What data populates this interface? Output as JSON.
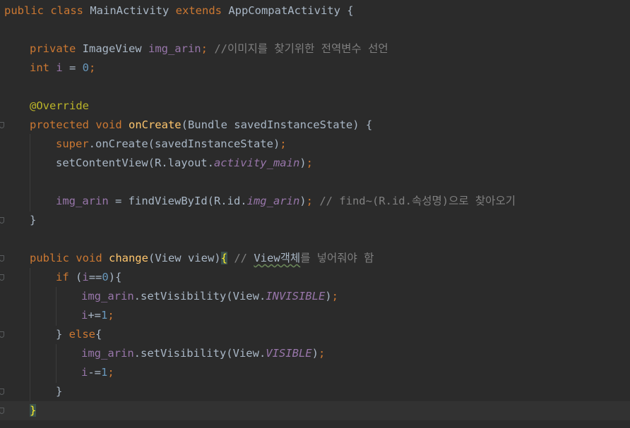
{
  "editor": {
    "lines": [
      {
        "tokens": [
          [
            "kw",
            "public class "
          ],
          [
            "plain",
            "MainActivity "
          ],
          [
            "kw",
            "extends "
          ],
          [
            "plain",
            "AppCompatActivity {"
          ]
        ]
      },
      {
        "tokens": []
      },
      {
        "tokens": [
          [
            "kw",
            "private "
          ],
          [
            "plain",
            "ImageView "
          ],
          [
            "fld",
            "img_arin"
          ],
          [
            "kw",
            "; "
          ],
          [
            "cmt",
            "//이미지를 찾기위한 전역변수 선언"
          ]
        ]
      },
      {
        "tokens": [
          [
            "kw",
            "int "
          ],
          [
            "fld",
            "i "
          ],
          [
            "plain",
            "= "
          ],
          [
            "num",
            "0"
          ],
          [
            "kw",
            ";"
          ]
        ]
      },
      {
        "tokens": []
      },
      {
        "tokens": [
          [
            "ann",
            "@Override"
          ]
        ]
      },
      {
        "tokens": [
          [
            "kw",
            "protected void "
          ],
          [
            "fn",
            "onCreate"
          ],
          [
            "plain",
            "(Bundle savedInstanceState) {"
          ]
        ]
      },
      {
        "tokens": [
          [
            "kw",
            "super"
          ],
          [
            "plain",
            ".onCreate(savedInstanceState)"
          ],
          [
            "kw",
            ";"
          ]
        ]
      },
      {
        "tokens": [
          [
            "plain",
            "setContentView(R.layout."
          ],
          [
            "sfld",
            "activity_main"
          ],
          [
            "plain",
            ")"
          ],
          [
            "kw",
            ";"
          ]
        ]
      },
      {
        "tokens": []
      },
      {
        "tokens": [
          [
            "fld",
            "img_arin "
          ],
          [
            "plain",
            "= findViewById(R.id."
          ],
          [
            "sfld",
            "img_arin"
          ],
          [
            "plain",
            ")"
          ],
          [
            "kw",
            "; "
          ],
          [
            "cmt",
            "// find~(R.id.속성명)으로 찾아오기"
          ]
        ]
      },
      {
        "tokens": [
          [
            "plain",
            "}"
          ]
        ]
      },
      {
        "tokens": []
      },
      {
        "tokens": [
          [
            "kw",
            "public void "
          ],
          [
            "fn",
            "change"
          ],
          [
            "plain",
            "(View view)"
          ],
          [
            "brace-hl",
            "{"
          ],
          [
            "plain",
            " "
          ],
          [
            "cmt",
            "// "
          ],
          [
            "squig",
            "View객체"
          ],
          [
            "cmt",
            "를 넣어줘야 함"
          ]
        ]
      },
      {
        "tokens": [
          [
            "kw",
            "if "
          ],
          [
            "plain",
            "("
          ],
          [
            "fld",
            "i"
          ],
          [
            "plain",
            "=="
          ],
          [
            "num",
            "0"
          ],
          [
            "plain",
            "){"
          ]
        ]
      },
      {
        "tokens": [
          [
            "fld",
            "img_arin"
          ],
          [
            "plain",
            ".setVisibility(View."
          ],
          [
            "sfld",
            "INVISIBLE"
          ],
          [
            "plain",
            ")"
          ],
          [
            "kw",
            ";"
          ]
        ]
      },
      {
        "tokens": [
          [
            "fld",
            "i"
          ],
          [
            "plain",
            "+="
          ],
          [
            "num",
            "1"
          ],
          [
            "kw",
            ";"
          ]
        ]
      },
      {
        "tokens": [
          [
            "plain",
            "} "
          ],
          [
            "kw",
            "else"
          ],
          [
            "plain",
            "{"
          ]
        ]
      },
      {
        "tokens": [
          [
            "fld",
            "img_arin"
          ],
          [
            "plain",
            ".setVisibility(View."
          ],
          [
            "sfld",
            "VISIBLE"
          ],
          [
            "plain",
            ")"
          ],
          [
            "kw",
            ";"
          ]
        ]
      },
      {
        "tokens": [
          [
            "fld",
            "i"
          ],
          [
            "plain",
            "-="
          ],
          [
            "num",
            "1"
          ],
          [
            "kw",
            ";"
          ]
        ]
      },
      {
        "tokens": [
          [
            "plain",
            "}"
          ]
        ]
      },
      {
        "tokens": [
          [
            "brace-hl",
            "}"
          ]
        ]
      }
    ]
  }
}
